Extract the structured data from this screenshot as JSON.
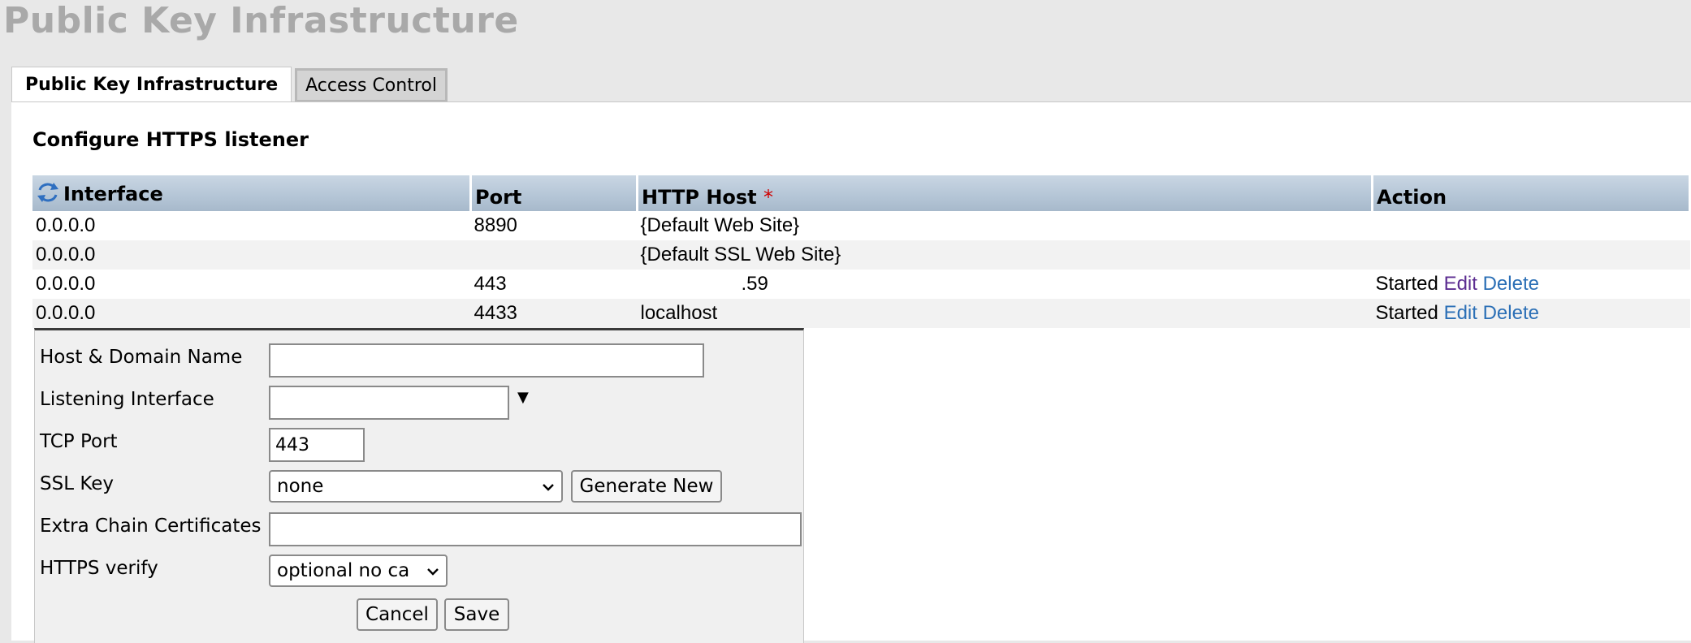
{
  "page": {
    "title": "Public Key Infrastructure"
  },
  "tabs": [
    {
      "label": "Public Key Infrastructure"
    },
    {
      "label": "Access Control"
    }
  ],
  "section_title": "Configure HTTPS listener",
  "table": {
    "headers": {
      "interface": "Interface",
      "port": "Port",
      "http_host": "HTTP Host",
      "required_mark": "*",
      "action": "Action"
    },
    "rows": [
      {
        "interface": "0.0.0.0",
        "port": "8890",
        "host": "{Default Web Site}",
        "status": "",
        "edit": "",
        "delete": ""
      },
      {
        "interface": "0.0.0.0",
        "port": "",
        "host": "{Default SSL Web Site}",
        "status": "",
        "edit": "",
        "delete": ""
      },
      {
        "interface": "0.0.0.0",
        "port": "443",
        "host": ".59",
        "status": "Started",
        "edit": "Edit",
        "delete": "Delete"
      },
      {
        "interface": "0.0.0.0",
        "port": "4433",
        "host": "localhost",
        "status": "Started",
        "edit": "Edit",
        "delete": "Delete"
      }
    ]
  },
  "form": {
    "host_label": "Host & Domain Name",
    "host_value": "",
    "interface_label": "Listening Interface",
    "interface_value": "",
    "port_label": "TCP Port",
    "port_value": "443",
    "ssl_key_label": "SSL Key",
    "ssl_key_value": "none",
    "generate_label": "Generate New",
    "chain_label": "Extra Chain Certificates",
    "chain_value": "",
    "verify_label": "HTTPS verify",
    "verify_value": "optional no ca",
    "cancel_label": "Cancel",
    "save_label": "Save"
  },
  "colors": {
    "header_bg": "#b4c5d6",
    "title_gray": "#a9a9a9",
    "link_visited": "#5c2d91",
    "link": "#2b6fb6"
  }
}
